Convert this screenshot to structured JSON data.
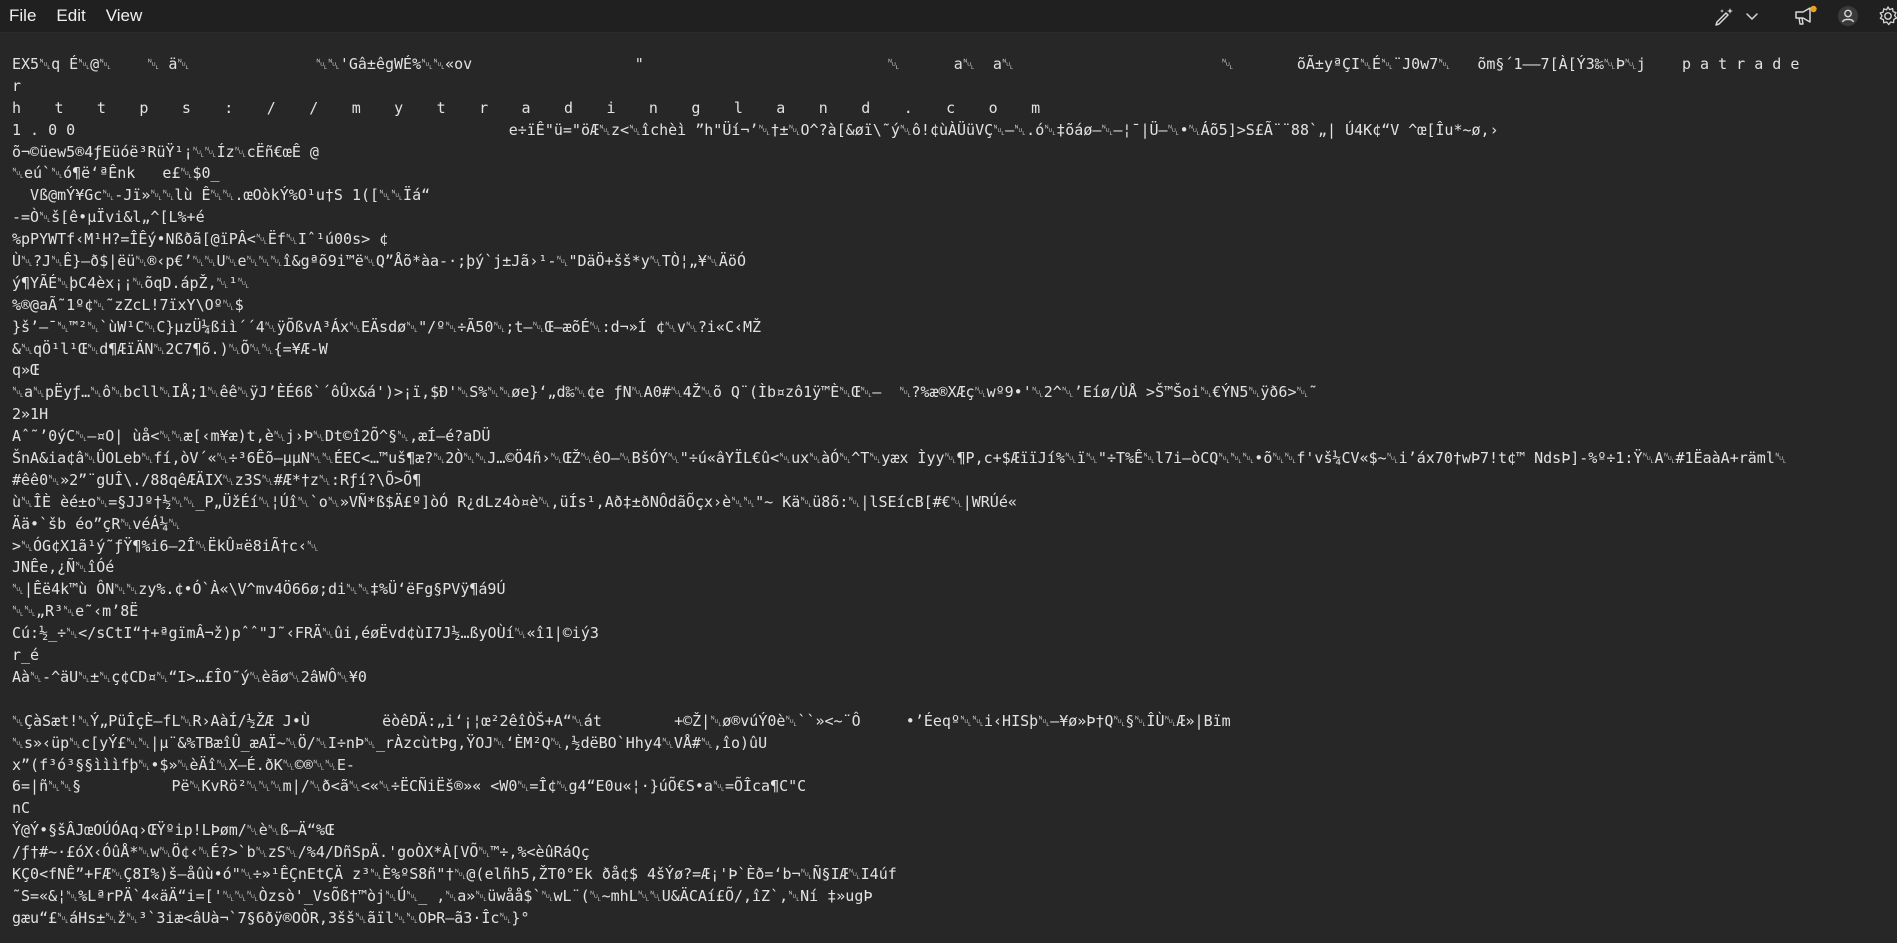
{
  "menu": {
    "file_label": "File",
    "edit_label": "Edit",
    "view_label": "View"
  },
  "toolbar": {
    "icons": [
      "copilot-pen-icon",
      "chevron-down-icon",
      "feedback-icon",
      "account-icon",
      "gear-icon"
    ]
  },
  "colors": {
    "background": "#202020",
    "editor_background": "#272727",
    "text": "#e2e2e2",
    "notification_dot": "#e8a21f"
  },
  "editor": {
    "lines": [
      "EX5␀q É␀@␀    ␀ ä␀              ␀␀'Gâ±êgWÉ%␀␀«ov                  \"                           ␀      a␀  a␀                       ␀       õÃ±yªÇI␀É␀¨J0w7␀   õm§´1——7[À[Ý3‰␀Þ␀j    p a t r a d e",
      "r",
      "h t t p s : / / m y t r a d i n g l a n d . c o m",
      "1 . 0 0                                                e÷ïÊ\"ü=\"öÆ␀z<␀îchèì ”h\"Üí¬’␀†±␀O^?à[&øï\\˜ý␀ô!¢ùÀÜüVÇ␀—␀.ó␀‡õáø—␀–¦¯|Ü—␀•␀Áõ5]>S£Ã¨¨88`„| Ú4K¢“V ^œ[Îu*~ø,›",
      "õ¬©üew5®4ƒEüóë³RüŸ¹¡␀␀Íz␀cËñ€œÊ @",
      "␀eú`␀ó¶ë‘ªÊnk   e£␀$0_",
      "  Vß@mÝ¥Gc␀-Jï»␀␀lù Ê␀␀.œOòkÝ%O¹u†S 1([␀␀Ïá“",
      "-=Ò␀š[ê•µÏvi&l„^[L%+é",
      "%pPYWTf‹M¹H?=ÎÊý•Nßðã[@ïPÂ<␀Ëf␀Iˆ¹ú00s> ¢",
      "Ù␀?J␀Ê}–ð$|ëü␀®‹p€’␀␀U␀e␀␀␀î&gªõ9i™ë␀Q”Åõ*àa-·;þý`j±Jã›¹-␀\"DäÖ+šš*y␀TÒ¦„¥␀ÄöÓ",
      "ý¶YÃÉ␀þC4èx¡¡␀õqD.ápŽ,␀¹␀",
      "%®@aÃ˜1º¢␀˜zZcL!7ïxY\\Oº␀$",
      "}š’–¯␀™²␀`ùW¹C␀C}µzÜ¼ßiì´´4␀ÿÕßvA³Áx␀EÄsdø␀\"/º␀÷Ã50␀;t–␀Œ—æõÉ␀:d¬»Í ¢␀v␀?i«C‹MŽ",
      "&␀qÖ¹l¹Œ␀d¶ÆïÄN␀2C7¶õ.)␀Õ␀␀{=¥Æ-W",
      "q»Œ",
      "␀a␀pËyƒ…␀ô␀bcll␀IÅ;1␀êê␀ÿJ’ÈÉ6ß`´ôÛx&á')>¡ï,$Ð'␀S%␀␀øe}‘„d‰␀¢e ƒN␀A0#␀4Ž␀õ Q¨(Ìb¤zô1ÿ™È␀Œ␀—  ␀?%æ®XÆç␀wº9•'␀2^␀’Eíø/ÙÅ >Š™Šoi␀€ÝN5␀ÿð6>␀˜",
      "2»1H",
      "Aˆ˜’0ýC␀–¤O| ùå<␀␀æ[‹m¥æ)t,è␀j›Þ␀Dt©î2Õ^§␀,æÍ–é?aDÜ",
      "ŠnA&ia¢â␀ÛOLeb␀fí,òV´«␀÷³6Êõ–µµN␀␀ÉEC<…™uš¶æ?␀2Ò␀␀J…©Ö4ñ›␀ŒŽ␀êO–␀BšÓY␀\"÷ú«âYÏL€û<␀ux␀àÓ␀^T␀yæx Ìyy␀¶P,c+$ÆïïJí%␀ï␀\"÷T%Ê␀l7i–òCQ␀␀␀•õ␀␀f'vš¼CV«$~␀i’áx70†wÞ7!t¢™ NdsÞ]-%º÷1:Ÿ␀A␀#1ËaàA+räml␀",
      "#êê0␀»2”¨gUÎ\\./88qêÆÄIX␀z3S␀#Æ*†z␀:Rƒí?\\Õ>Õ¶",
      "ù␀ÎÈ èé±o␀=§JJº†½␀␀_P„ÜžÉí␀¦Úî␀`o␀»VÑ*ß$Ä£º]òÓ R¿dLz4ò¤è␀,üÍs¹,Að‡±ðNÔdãÕçx›è␀␀\"~ Kä␀ü8õ:␀|lSEícB[#€␀|WRÚé«",
      "Ää•`šb éo”çR␀véÁ¼␀",
      ">␀ÓG¢X1ã¹ý˜ƒŸ¶%i6–2Î␀ËkÛ¤ë8iÃ†c‹␀",
      "JNÊe,¿Ñ␀îÓé",
      "␀|Êë4k™ù ÔN␀␀zy%.¢•Ó`À«\\V^mv4Ö66ø;di␀␀‡%Ü‘ëFg§PVÿ¶á9Ú",
      "␀␀„R³␀e˜‹m’8Ë",
      "Cú:½_÷␀</sCtI“†+ªgïmÂ¬ž)pˆˆ\"J˜‹FRÄ␀ûi,éøËvd¢ùI7J½…ßyOÙí␀«î1|©iý3",
      "r_é",
      "Aà␀-^äU␀±␀ç¢CD¤␀“I>…£ÎO˜ý␀èãø␀2âWÔ␀¥0",
      "",
      "␀ÇàSæt!␀Ý„PüÎçÈ–fL␀R›AàÍ/½ŽÆ J•Ù        ëòêDÄ:„i‘¡¦œ²2êîÒŠ+A“␀át        +©Ž|␀ø®vúÝ0è␀``»<~¨Ô     •’Éeqº␀␀i‹HISþ␀—¥ø»Þ†Q␀§␀ÎÙ␀Æ»|Bïm",
      "␀s»‹üp␀c[yÝ£␀␀|µ¨&%TBæîÛ_æAÏ~␀Ö/␀I÷nÞ␀_rÀzcùtÞg,ŸOJ␀‘ÈM²Q␀,½dëBO`Hhy4␀VÅ#␀,îo)ûU",
      "x”(f³ó³§§ìììfþ␀•$»␀èÄî␀X–É.ðK␀©®␀␀E-",
      "6=|ñ␀␀§          Pë␀KvRö²␀␀␀m|/␀ð<ã␀<«␀÷ËCÑiËš®»« <W0␀=Î¢␀g4“E0u«¦·}úÕ€S•a␀=ÕÎca¶C\"C",
      "nC",
      "Ý@Ý•§šÂJœOÚÓAq›ŒŸºip!LÞøm/␀è␀ß—Ä“%Œ",
      "/ƒ†#~·£óX‹ÓûÅ*␀w␀Ö¢‹␀É?>`b␀zS␀/%4/DñSpÄ.'goÒX*À[VÕ␀™÷,%<èûRáQç",
      "KÇ0<fNÊ”+FÆ␀Ç8I%)š–åûù•ó\"␀÷»¹ÊÇnEtÇÄ z³␀È%ºS8ñ\"†␀@(elñh5,ŽT0°Ek ðå¢$ 4šÝø?=Æ¡'Þ`Èð=‘b¬␀Ñ§IÆ␀I4úf",
      "˜S=«&¦␀%LªrPÄ`4«äÄ“i=['␀␀␀Òzsò'_VsÕß†™òj␀Ú␀_ ,␀a»␀üwåå$`␀wL¨(␀~mhL␀␀U&ÄCAí£Õ/,îZ`,␀Ní ‡»ugÞ",
      "gæu“£␀áHs±␀ž␀³`3iæ<âUà¬`7§6ðÿ®OÒR,3šš␀ãïl␀␀OÞR–ã3·Îc␀}°"
    ]
  }
}
